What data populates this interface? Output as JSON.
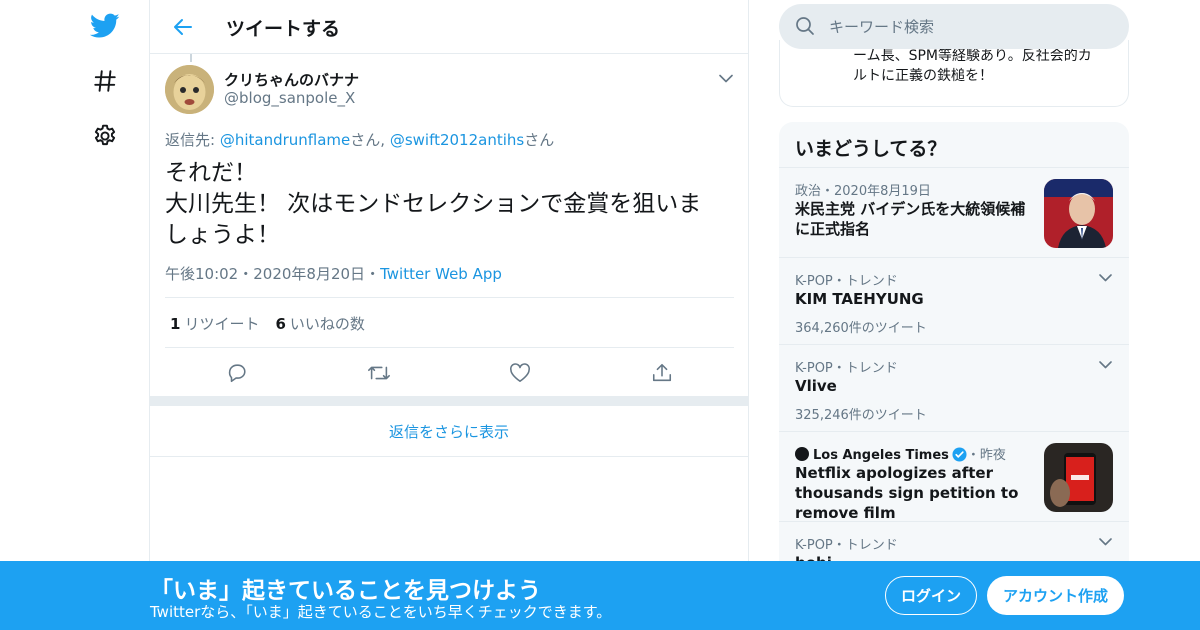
{
  "colors": {
    "accent": "#1da1f2",
    "link": "#1b95e0",
    "text": "#14171a",
    "secondary": "#657786",
    "border": "#e6ecf0"
  },
  "nav": {
    "icons": [
      "twitter-bird-icon",
      "hashtag-icon",
      "gear-icon"
    ]
  },
  "header": {
    "back_icon": "back-arrow-icon",
    "title": "ツイートする"
  },
  "tweet": {
    "author_name": "クリちゃんのバナナ",
    "author_handle": "@blog_sanpole_X",
    "reply_prefix": "返信先: ",
    "reply_user1": "@hitandrunflame",
    "reply_sep": "さん, ",
    "reply_user2": "@swift2012antihs",
    "reply_suffix": "さん",
    "text_lines": [
      "それだ！",
      "大川先生！ 次はモンドセレクションで金賞を狙いま",
      "しょうよ！"
    ],
    "time": "午後10:02",
    "dot": "・",
    "date": "2020年8月20日",
    "client": "Twitter Web App",
    "retweet_count": "1",
    "retweet_label": "リツイート",
    "like_count": "6",
    "like_label": "いいねの数",
    "actions": [
      "reply-icon",
      "retweet-icon",
      "like-icon",
      "share-icon"
    ]
  },
  "show_more": "返信をさらに表示",
  "search": {
    "placeholder": "キーワード検索",
    "icon": "search-icon"
  },
  "bio_card": {
    "line1": "ーム長、SPM等経験あり。反社会的カ",
    "line2": "ルトに正義の鉄槌を！"
  },
  "trends": {
    "title": "いまどうしてる？",
    "items": [
      {
        "meta": "政治・2020年8月19日",
        "title": "米民主党 バイデン氏を大統領候補に正式指名",
        "image": "politician-photo"
      },
      {
        "meta": "K-POP・トレンド",
        "title": "KIM TAEHYUNG",
        "count": "364,260件のツイート"
      },
      {
        "meta": "K-POP・トレンド",
        "title": "Vlive",
        "count": "325,246件のツイート"
      },
      {
        "source": "Los Angeles Times",
        "time": "・昨夜",
        "title": "Netflix apologizes after thousands sign petition to remove film",
        "image": "netflix-phone-photo"
      },
      {
        "meta": "K-POP・トレンド",
        "title": "bobi"
      }
    ]
  },
  "banner": {
    "title": "「いま」起きていることを見つけよう",
    "subtitle": "Twitterなら、「いま」起きていることをいち早くチェックできます。",
    "login": "ログイン",
    "signup": "アカウント作成"
  }
}
